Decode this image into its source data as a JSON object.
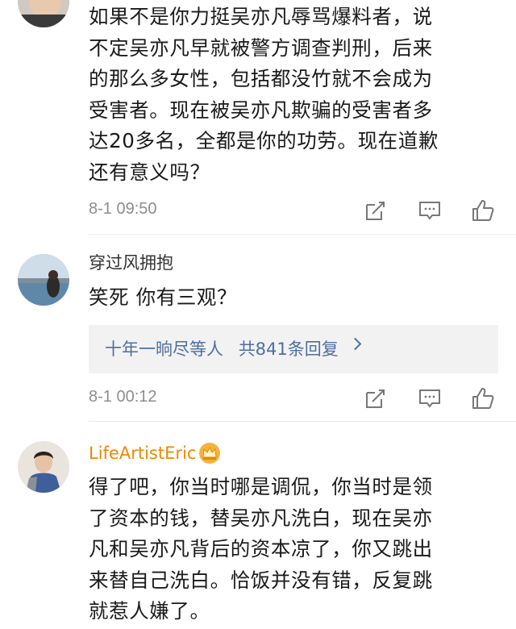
{
  "comments": [
    {
      "text": "如果不是你力挺吴亦凡辱骂爆料者，说\n不定吴亦凡早就被警方调查判刑，后来\n的那么多女性，包括都没竹就不会成为\n受害者。现在被吴亦凡欺骗的受害者多\n达20多名，全都是你的功劳。现在道歉\n还有意义吗？",
      "timestamp": "8-1 09:50"
    },
    {
      "username": "穿过风拥抱",
      "text": "笑死 你有三观？",
      "reply_preview": {
        "names": "十年一晌尽等人",
        "count_text": "共841条回复"
      },
      "timestamp": "8-1 00:12"
    },
    {
      "username": "LifeArtistEric",
      "text": "得了吧，你当时哪是调侃，你当时是领\n了资本的钱，替吴亦凡洗白，现在吴亦\n凡和吴亦凡背后的资本凉了，你又跳出\n来替自己洗白。恰饭并没有错，反复跳\n就惹人嫌了。"
    }
  ],
  "icons": {
    "share": "share-icon",
    "reply": "comment-icon",
    "like": "thumbs-up-icon",
    "vip": "crown-icon"
  },
  "colors": {
    "vip_name": "#ee8800",
    "reply_link": "#4e6fa0",
    "timestamp": "#8d8d8d",
    "reply_box_bg": "#f2f2f2"
  }
}
